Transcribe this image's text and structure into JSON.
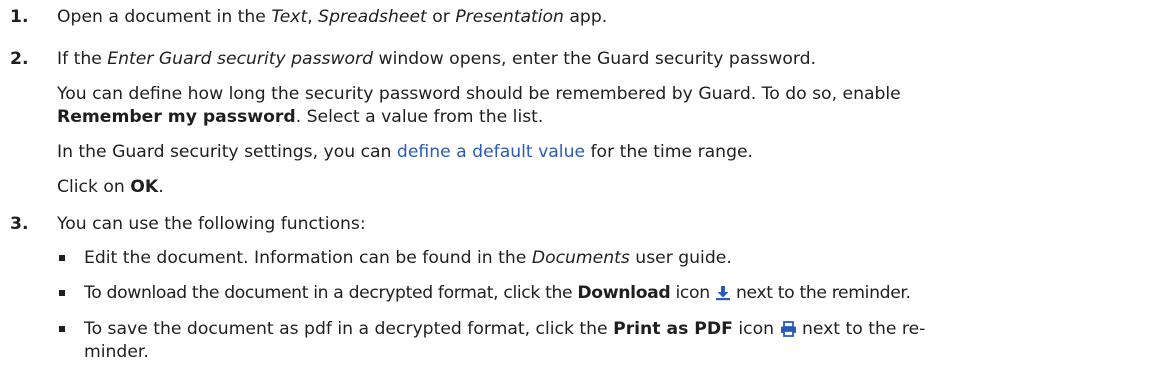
{
  "steps": [
    {
      "num": "1.",
      "t1": "Open a document in the ",
      "t2": "Text",
      "t3": ", ",
      "t4": "Spreadsheet",
      "t5": " or ",
      "t6": "Presentation",
      "t7": " app."
    },
    {
      "num": "2.",
      "l1a": "If the ",
      "l1b": "Enter Guard security password",
      "l1c": " window opens, enter the Guard security password.",
      "l2": "You can define how long the security password should be remembered by Guard. To do so, enable",
      "l3a": "Remember my password",
      "l3b": ". Select a value from the list.",
      "l4a": "In the Guard security settings, you can ",
      "l4link": "define a default value",
      "l4b": " for the time range.",
      "l5a": "Click on ",
      "l5b": "OK",
      "l5c": "."
    },
    {
      "num": "3.",
      "intro": "You can use the following functions:",
      "bullets": [
        {
          "a": "Edit the document. Information can be found in the ",
          "b": "Documents",
          "c": " user guide."
        },
        {
          "a": "To download the document in a decrypted format, click the ",
          "b": "Download",
          "c": " icon",
          "d": " next to the reminder.",
          "icon": "download-icon"
        },
        {
          "a": "To save the document as pdf in a decrypted format, click the ",
          "b": "Print as PDF",
          "c": " icon",
          "d": " next to the re-",
          "e": "minder.",
          "icon": "print-icon"
        }
      ]
    }
  ],
  "colors": {
    "text": "#1f1f1f",
    "link": "#2a5bb8",
    "icon": "#2a5bb8"
  }
}
